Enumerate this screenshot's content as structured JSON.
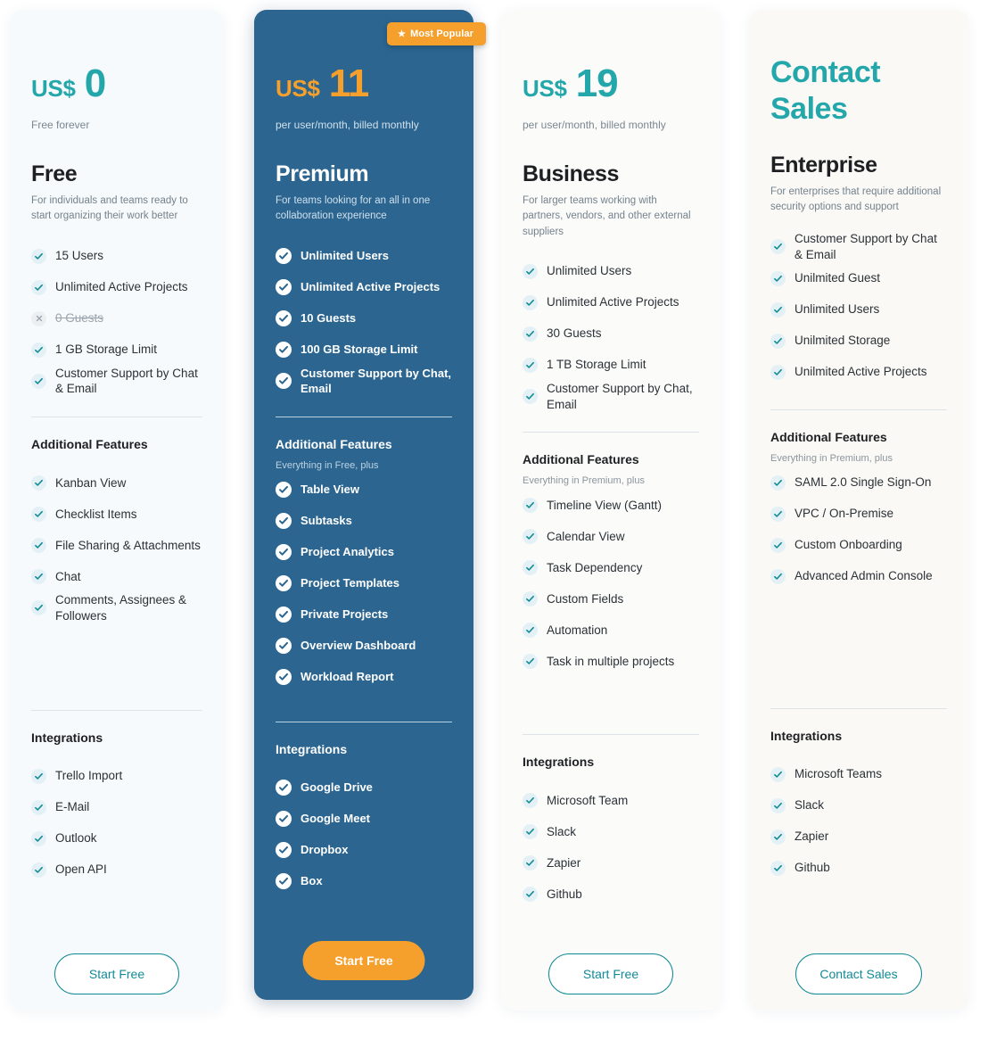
{
  "icons": {
    "check": "check-icon",
    "cross": "cross-icon",
    "star": "star-icon"
  },
  "colors": {
    "teal": "#23a7ab",
    "orange": "#f5a02d",
    "premium_bg": "#2b6590",
    "button_outline": "#118a96"
  },
  "badge": {
    "star": "★",
    "label": "Most Popular"
  },
  "sections": {
    "additional_features": "Additional Features",
    "integrations": "Integrations"
  },
  "plans": [
    {
      "id": "free",
      "currency": "US$",
      "amount": "0",
      "price_note": "Free forever",
      "name": "Free",
      "description": "For individuals and teams ready to start organizing their work better",
      "features": [
        {
          "label": "15 Users",
          "included": true
        },
        {
          "label": "Unlimited Active Projects",
          "included": true
        },
        {
          "label": "0 Guests",
          "included": false
        },
        {
          "label": "1 GB Storage Limit",
          "included": true
        },
        {
          "label": "Customer Support by Chat & Email",
          "included": true
        }
      ],
      "additional_subtitle": "",
      "additional_features": [
        {
          "label": "Kanban View",
          "included": true
        },
        {
          "label": "Checklist Items",
          "included": true
        },
        {
          "label": "File Sharing & Attachments",
          "included": true
        },
        {
          "label": "Chat",
          "included": true
        },
        {
          "label": "Comments, Assignees & Followers",
          "included": true
        }
      ],
      "integrations": [
        {
          "label": "Trello Import",
          "included": true
        },
        {
          "label": "E-Mail",
          "included": true
        },
        {
          "label": "Outlook",
          "included": true
        },
        {
          "label": "Open API",
          "included": true
        }
      ],
      "cta": "Start Free"
    },
    {
      "id": "premium",
      "currency": "US$",
      "amount": "11",
      "price_note": "per user/month, billed monthly",
      "name": "Premium",
      "description": "For teams looking for an all in one collaboration experience",
      "features": [
        {
          "label": "Unlimited Users",
          "included": true
        },
        {
          "label": "Unlimited Active Projects",
          "included": true
        },
        {
          "label": "10 Guests",
          "included": true
        },
        {
          "label": "100 GB Storage Limit",
          "included": true
        },
        {
          "label": "Customer Support by Chat, Email",
          "included": true
        }
      ],
      "additional_subtitle": "Everything in Free, plus",
      "additional_features": [
        {
          "label": "Table View",
          "included": true
        },
        {
          "label": "Subtasks",
          "included": true
        },
        {
          "label": "Project Analytics",
          "included": true
        },
        {
          "label": "Project Templates",
          "included": true
        },
        {
          "label": "Private Projects",
          "included": true
        },
        {
          "label": "Overview Dashboard",
          "included": true
        },
        {
          "label": "Workload Report",
          "included": true
        }
      ],
      "integrations": [
        {
          "label": "Google Drive",
          "included": true
        },
        {
          "label": "Google Meet",
          "included": true
        },
        {
          "label": "Dropbox",
          "included": true
        },
        {
          "label": "Box",
          "included": true
        }
      ],
      "cta": "Start Free"
    },
    {
      "id": "business",
      "currency": "US$",
      "amount": "19",
      "price_note": "per user/month, billed monthly",
      "name": "Business",
      "description": "For larger teams working with partners, vendors, and other external suppliers",
      "features": [
        {
          "label": "Unlimited Users",
          "included": true
        },
        {
          "label": "Unlimited Active Projects",
          "included": true
        },
        {
          "label": "30 Guests",
          "included": true
        },
        {
          "label": "1 TB Storage Limit",
          "included": true
        },
        {
          "label": "Customer Support by Chat, Email",
          "included": true
        }
      ],
      "additional_subtitle": "Everything in Premium, plus",
      "additional_features": [
        {
          "label": "Timeline View (Gantt)",
          "included": true
        },
        {
          "label": "Calendar View",
          "included": true
        },
        {
          "label": "Task Dependency",
          "included": true
        },
        {
          "label": "Custom Fields",
          "included": true
        },
        {
          "label": "Automation",
          "included": true
        },
        {
          "label": "Task in multiple projects",
          "included": true
        }
      ],
      "integrations": [
        {
          "label": "Microsoft Team",
          "included": true
        },
        {
          "label": "Slack",
          "included": true
        },
        {
          "label": "Zapier",
          "included": true
        },
        {
          "label": "Github",
          "included": true
        }
      ],
      "cta": "Start Free"
    },
    {
      "id": "enterprise",
      "headline": "Contact Sales",
      "name": "Enterprise",
      "description": "For enterprises that require additional security options and support",
      "features": [
        {
          "label": "Customer Support by Chat & Email",
          "included": true
        },
        {
          "label": "Unilmited Guest",
          "included": true
        },
        {
          "label": "Unlimited Users",
          "included": true
        },
        {
          "label": "Unilmited Storage",
          "included": true
        },
        {
          "label": "Unilmited Active Projects",
          "included": true
        }
      ],
      "additional_subtitle": "Everything in Premium, plus",
      "additional_features": [
        {
          "label": "SAML 2.0 Single Sign-On",
          "included": true
        },
        {
          "label": "VPC / On-Premise",
          "included": true
        },
        {
          "label": "Custom Onboarding",
          "included": true
        },
        {
          "label": "Advanced Admin Console",
          "included": true
        }
      ],
      "integrations": [
        {
          "label": "Microsoft Teams",
          "included": true
        },
        {
          "label": "Slack",
          "included": true
        },
        {
          "label": "Zapier",
          "included": true
        },
        {
          "label": "Github",
          "included": true
        }
      ],
      "cta": "Contact Sales"
    }
  ]
}
